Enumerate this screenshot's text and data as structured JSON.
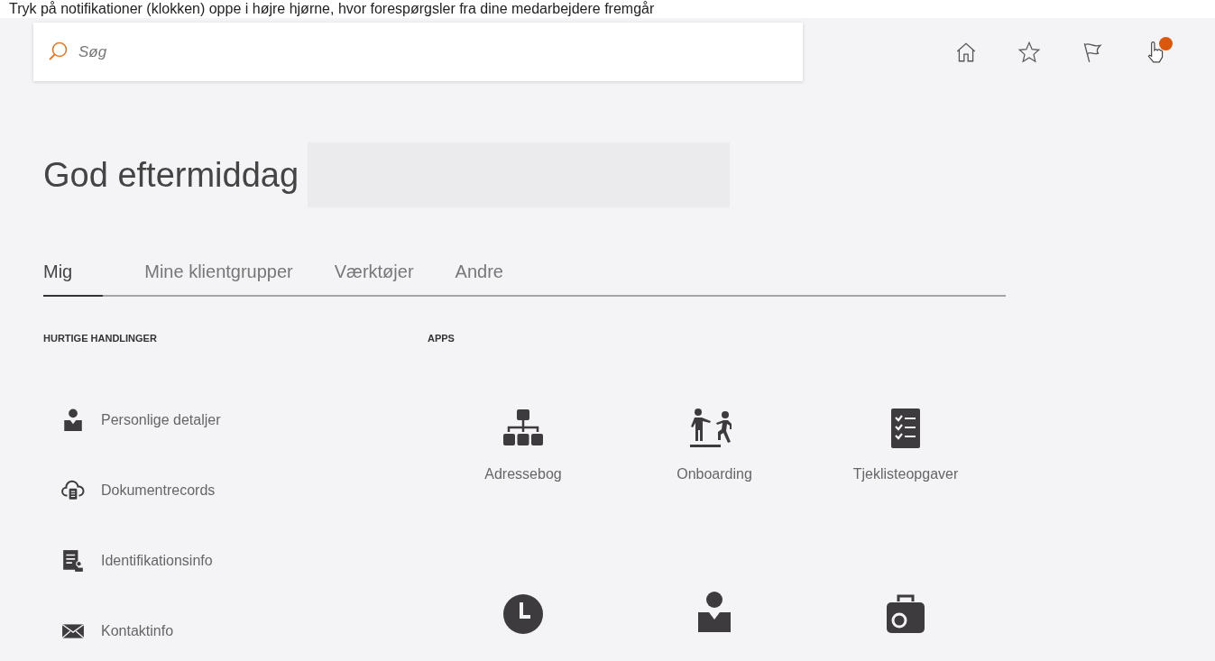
{
  "caption": "Tryk på notifikationer (klokken) oppe i højre hjørne, hvor forespørgsler fra dine medarbejdere fremgår",
  "search": {
    "placeholder": "Søg"
  },
  "toolbar": [
    {
      "kind": "home"
    },
    {
      "kind": "star"
    },
    {
      "kind": "flag"
    },
    {
      "kind": "hand",
      "badge": true
    }
  ],
  "greeting": "God eftermiddag",
  "tabs": [
    {
      "label": "Mig",
      "selected": true
    },
    {
      "label": "Mine klientgrupper",
      "selected": false
    },
    {
      "label": "Værktøjer",
      "selected": false
    },
    {
      "label": "Andre",
      "selected": false
    }
  ],
  "quick_actions": {
    "title": "HURTIGE HANDLINGER",
    "items": [
      {
        "label": "Personlige detaljer",
        "kind": "person"
      },
      {
        "label": "Dokumentrecords",
        "kind": "cloud"
      },
      {
        "label": "Identifikationsinfo",
        "kind": "idcard"
      },
      {
        "label": "Kontaktinfo",
        "kind": "mail"
      }
    ]
  },
  "apps": {
    "title": "APPS",
    "items": [
      {
        "label": "Adressebog",
        "kind": "org"
      },
      {
        "label": "Onboarding",
        "kind": "people"
      },
      {
        "label": "Tjeklisteopgaver",
        "kind": "checklist"
      },
      {
        "kind": "clock"
      },
      {
        "kind": "person"
      },
      {
        "kind": "case"
      }
    ]
  }
}
